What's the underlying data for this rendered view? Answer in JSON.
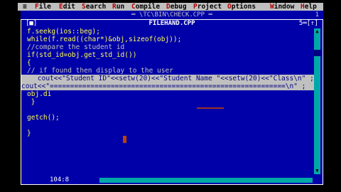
{
  "menubar": {
    "system": "≡",
    "items": [
      {
        "label": "File",
        "hotkey": "F"
      },
      {
        "label": "Edit",
        "hotkey": "E"
      },
      {
        "label": "Search",
        "hotkey": "S"
      },
      {
        "label": "Run",
        "hotkey": "R"
      },
      {
        "label": "Compile",
        "hotkey": "C"
      },
      {
        "label": "Debug",
        "hotkey": "D"
      },
      {
        "label": "Project",
        "hotkey": "P"
      },
      {
        "label": "Options",
        "hotkey": "O"
      },
      {
        "label": "Window",
        "hotkey": "W"
      },
      {
        "label": "Help",
        "hotkey": "H"
      }
    ]
  },
  "background_window": {
    "title": "═ \\TC\\BIN\\CHECK.CPP ═",
    "number": "1"
  },
  "editor": {
    "close_box": "[■]",
    "title": " FILEHAND.CPP ",
    "window_controls": "5═[↑]",
    "cursor_position": "104:8",
    "lines": [
      "f.seekg(ios::beg);",
      "while(f.read((char*)&obj,sizeof(obj));",
      "//compare the student id",
      "if(std_id=obj.get_std_id())",
      "{",
      "// if found then display to the user",
      "    cout<<\"Student ID\"<<setw(20)<<\"Student Name \"<<setw(20)<<\"Class\\n\" ;",
      "cout<<\"==========================================================\\n\" ;",
      "obj.di",
      " }",
      "",
      "getch();",
      "",
      "}"
    ]
  },
  "colors": {
    "editor_bg": "#0000a8",
    "code_text": "#ffff54",
    "comment_text": "#c0c0c0",
    "menubar_bg": "#bfbfbf",
    "hotkey": "#b00000"
  }
}
